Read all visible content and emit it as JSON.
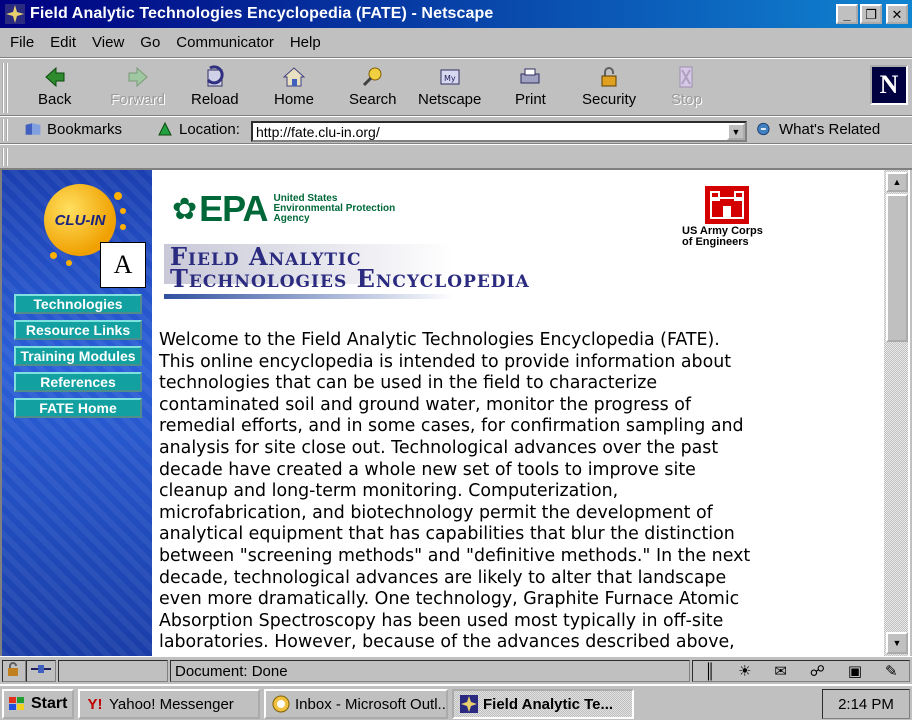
{
  "window": {
    "title": "Field Analytic Technologies Encyclopedia (FATE) - Netscape",
    "minimize": "_",
    "maximize": "❐",
    "close": "✕"
  },
  "menu": [
    "File",
    "Edit",
    "View",
    "Go",
    "Communicator",
    "Help"
  ],
  "toolbar": {
    "back": "Back",
    "forward": "Forward",
    "reload": "Reload",
    "home": "Home",
    "search": "Search",
    "netscape": "Netscape",
    "print": "Print",
    "security": "Security",
    "stop": "Stop",
    "logo": "N"
  },
  "location_bar": {
    "bookmarks": "Bookmarks",
    "location_label": "Location:",
    "url": "http://fate.clu-in.org/",
    "whats_related": "What's Related"
  },
  "sidebar": {
    "logo_text": "CLU-IN",
    "label_a": "A",
    "items": [
      "Technologies",
      "Resource Links",
      "Training Modules",
      "References",
      "FATE Home"
    ]
  },
  "page": {
    "epa_name": "EPA",
    "epa_sub": [
      "United States",
      "Environmental Protection",
      "Agency"
    ],
    "usace": [
      "US Army Corps",
      "of Engineers"
    ],
    "banner_line1": "Field Analytic",
    "banner_line2": "Technologies Encyclopedia",
    "body_lines": [
      "Welcome to the Field Analytic Technologies Encyclopedia (FATE).",
      "This online encyclopedia is intended to provide information about",
      "technologies that can be used in the field to characterize",
      "contaminated soil and ground water, monitor the progress of",
      "remedial efforts, and in some cases, for confirmation sampling and",
      "analysis for site close out. Technological advances over the past",
      "decade have created a whole new set of tools to improve site",
      "cleanup and long-term monitoring. Computerization,",
      "microfabrication, and biotechnology permit the development of",
      "analytical equipment that has capabilities that blur the distinction",
      "between \"screening methods\" and \"definitive methods.\" In the next",
      "decade, technological advances are likely to alter that landscape",
      "even more dramatically. One technology, Graphite Furnace Atomic",
      "Absorption Spectroscopy has been used most typically in off-site",
      "laboratories. However, because of the advances described above,"
    ]
  },
  "status": {
    "text": "Document: Done"
  },
  "taskbar": {
    "start": "Start",
    "tasks": [
      "Yahoo! Messenger",
      "Inbox - Microsoft Outl...",
      "Field Analytic Te..."
    ],
    "clock": "2:14 PM"
  }
}
